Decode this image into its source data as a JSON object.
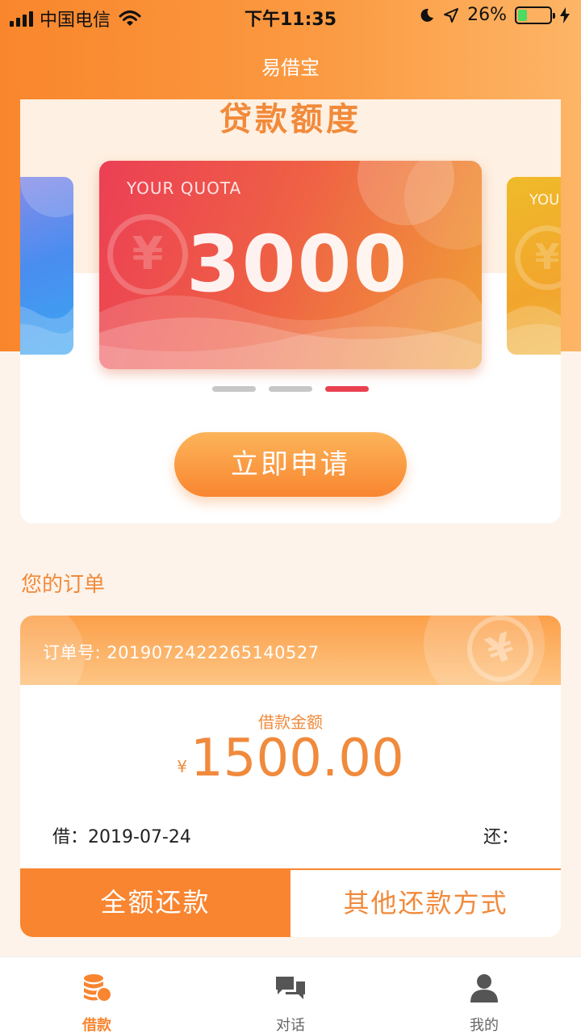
{
  "status_bar": {
    "carrier": "中国电信",
    "time": "下午11:35",
    "battery": "26%",
    "battery_level": 0.26,
    "icons": [
      "signal-icon",
      "wifi-icon",
      "moon-icon",
      "location-icon",
      "battery-icon",
      "charging-icon"
    ]
  },
  "nav": {
    "title": "易借宝"
  },
  "quota": {
    "title": "贷款额度",
    "card_label": "YOUR QUOTA",
    "amount": "3000",
    "side_card_label_partial": "YOU",
    "pager": {
      "count": 3,
      "active_index": 2
    },
    "apply_button": "立即申请",
    "colors": {
      "card_start": "#ec3f55",
      "card_end": "#f0a037",
      "active_dot": "#e94150"
    }
  },
  "orders": {
    "section_title": "您的订单",
    "order": {
      "order_no": "订单号: 2019072422265140527",
      "amount_label": "借款金额",
      "currency_symbol": "¥",
      "amount": "1500.00",
      "borrow_label": "借：",
      "borrow_date": "2019-07-24",
      "repay_label": "还：",
      "full_repay_button": "全额还款",
      "other_repay_button": "其他还款方式"
    }
  },
  "tabbar": {
    "items": [
      {
        "label": "借款",
        "icon": "coins-icon",
        "active": true
      },
      {
        "label": "对话",
        "icon": "chat-icon",
        "active": false
      },
      {
        "label": "我的",
        "icon": "user-icon",
        "active": false
      }
    ]
  },
  "colors": {
    "accent": "#f98530",
    "background": "#fdf3ea"
  }
}
